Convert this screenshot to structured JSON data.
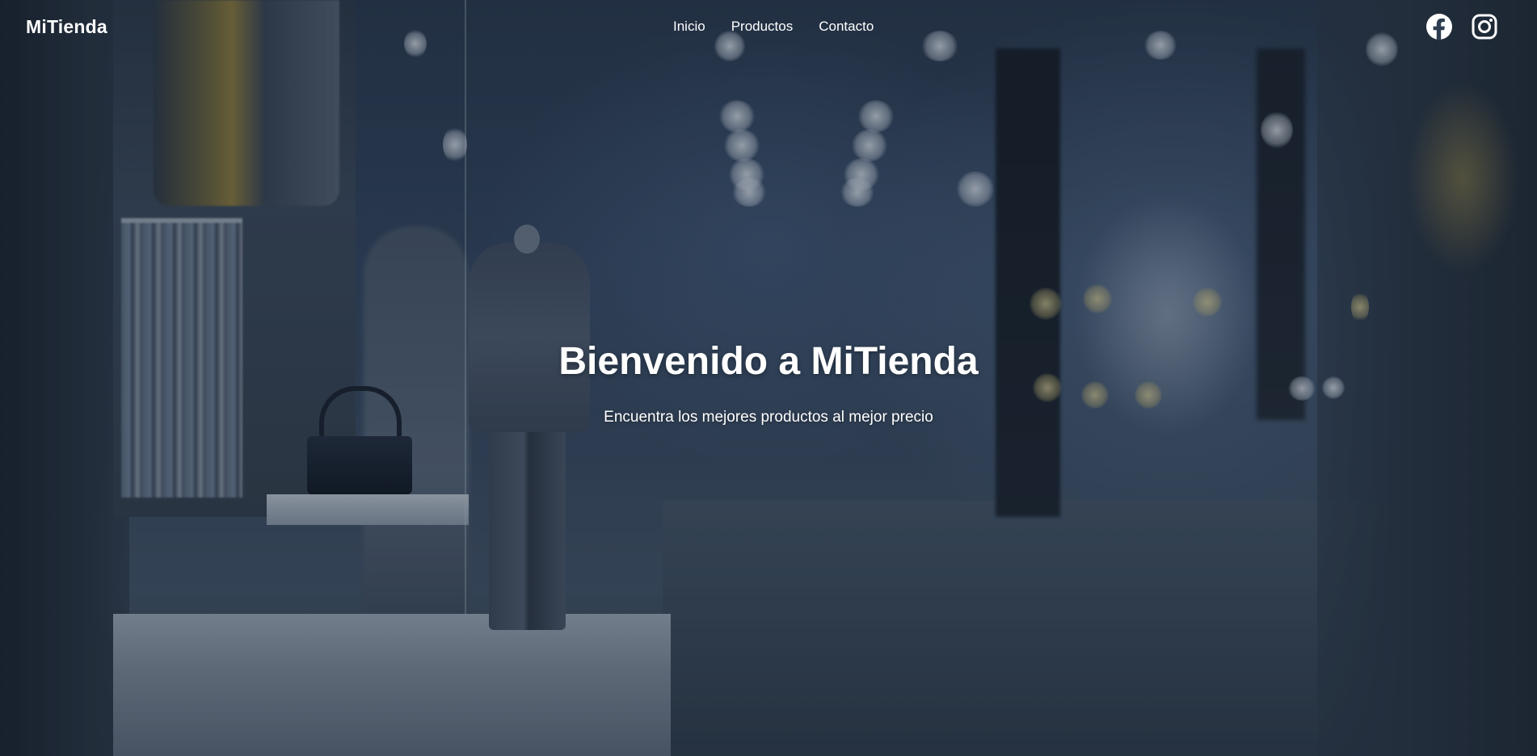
{
  "brand": {
    "name": "MiTienda"
  },
  "nav": {
    "links": [
      {
        "label": "Inicio"
      },
      {
        "label": "Productos"
      },
      {
        "label": "Contacto"
      }
    ]
  },
  "social": {
    "icons": [
      "facebook-icon",
      "instagram-icon"
    ]
  },
  "hero": {
    "title": "Bienvenido a MiTienda",
    "subtitle": "Encuentra los mejores productos al mejor precio"
  },
  "colors": {
    "text": "#ffffff",
    "background": "#2e3d50"
  }
}
